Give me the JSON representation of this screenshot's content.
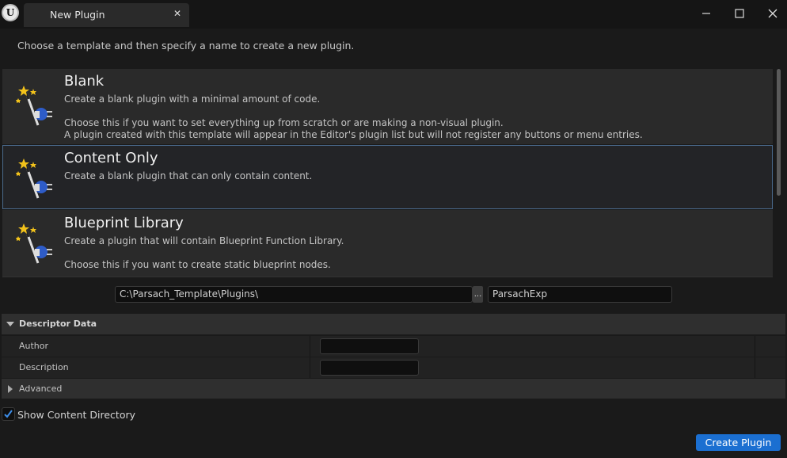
{
  "window": {
    "logo_letter": "U",
    "tab_title": "New Plugin",
    "tab_close_glyph": "✕",
    "controls": {
      "minimize": "minimize-icon",
      "maximize": "maximize-icon",
      "close": "close-icon"
    }
  },
  "instruction": "Choose a template and then specify a name to create a new plugin.",
  "templates": [
    {
      "title": "Blank",
      "icon": "plugin-wand-icon",
      "selected": false,
      "desc1": "Create a blank plugin with a minimal amount of code.",
      "desc2": "Choose this if you want to set everything up from scratch or are making a non-visual plugin.",
      "desc3": "A plugin created with this template will appear in the Editor's plugin list but will not register any buttons or menu entries."
    },
    {
      "title": "Content Only",
      "icon": "plugin-wand-icon",
      "selected": true,
      "desc1": "Create a blank plugin that can only contain content."
    },
    {
      "title": "Blueprint Library",
      "icon": "plugin-wand-icon",
      "selected": false,
      "desc1": "Create a plugin that will contain Blueprint Function Library.",
      "desc2": "Choose this if you want to create static blueprint nodes."
    }
  ],
  "path": {
    "value": "C:\\Parsach_Template\\Plugins\\",
    "browse_label": "...",
    "name_value": "ParsachExp"
  },
  "descriptor": {
    "section_label": "Descriptor Data",
    "author_label": "Author",
    "author_value": "",
    "description_label": "Description",
    "description_value": "",
    "advanced_label": "Advanced"
  },
  "show_content_directory": {
    "label": "Show Content Directory",
    "checked": true
  },
  "create_button": "Create Plugin",
  "colors": {
    "accent": "#1b6fd1",
    "selection_border": "#4a6a8c",
    "background": "#1a1a1a"
  }
}
